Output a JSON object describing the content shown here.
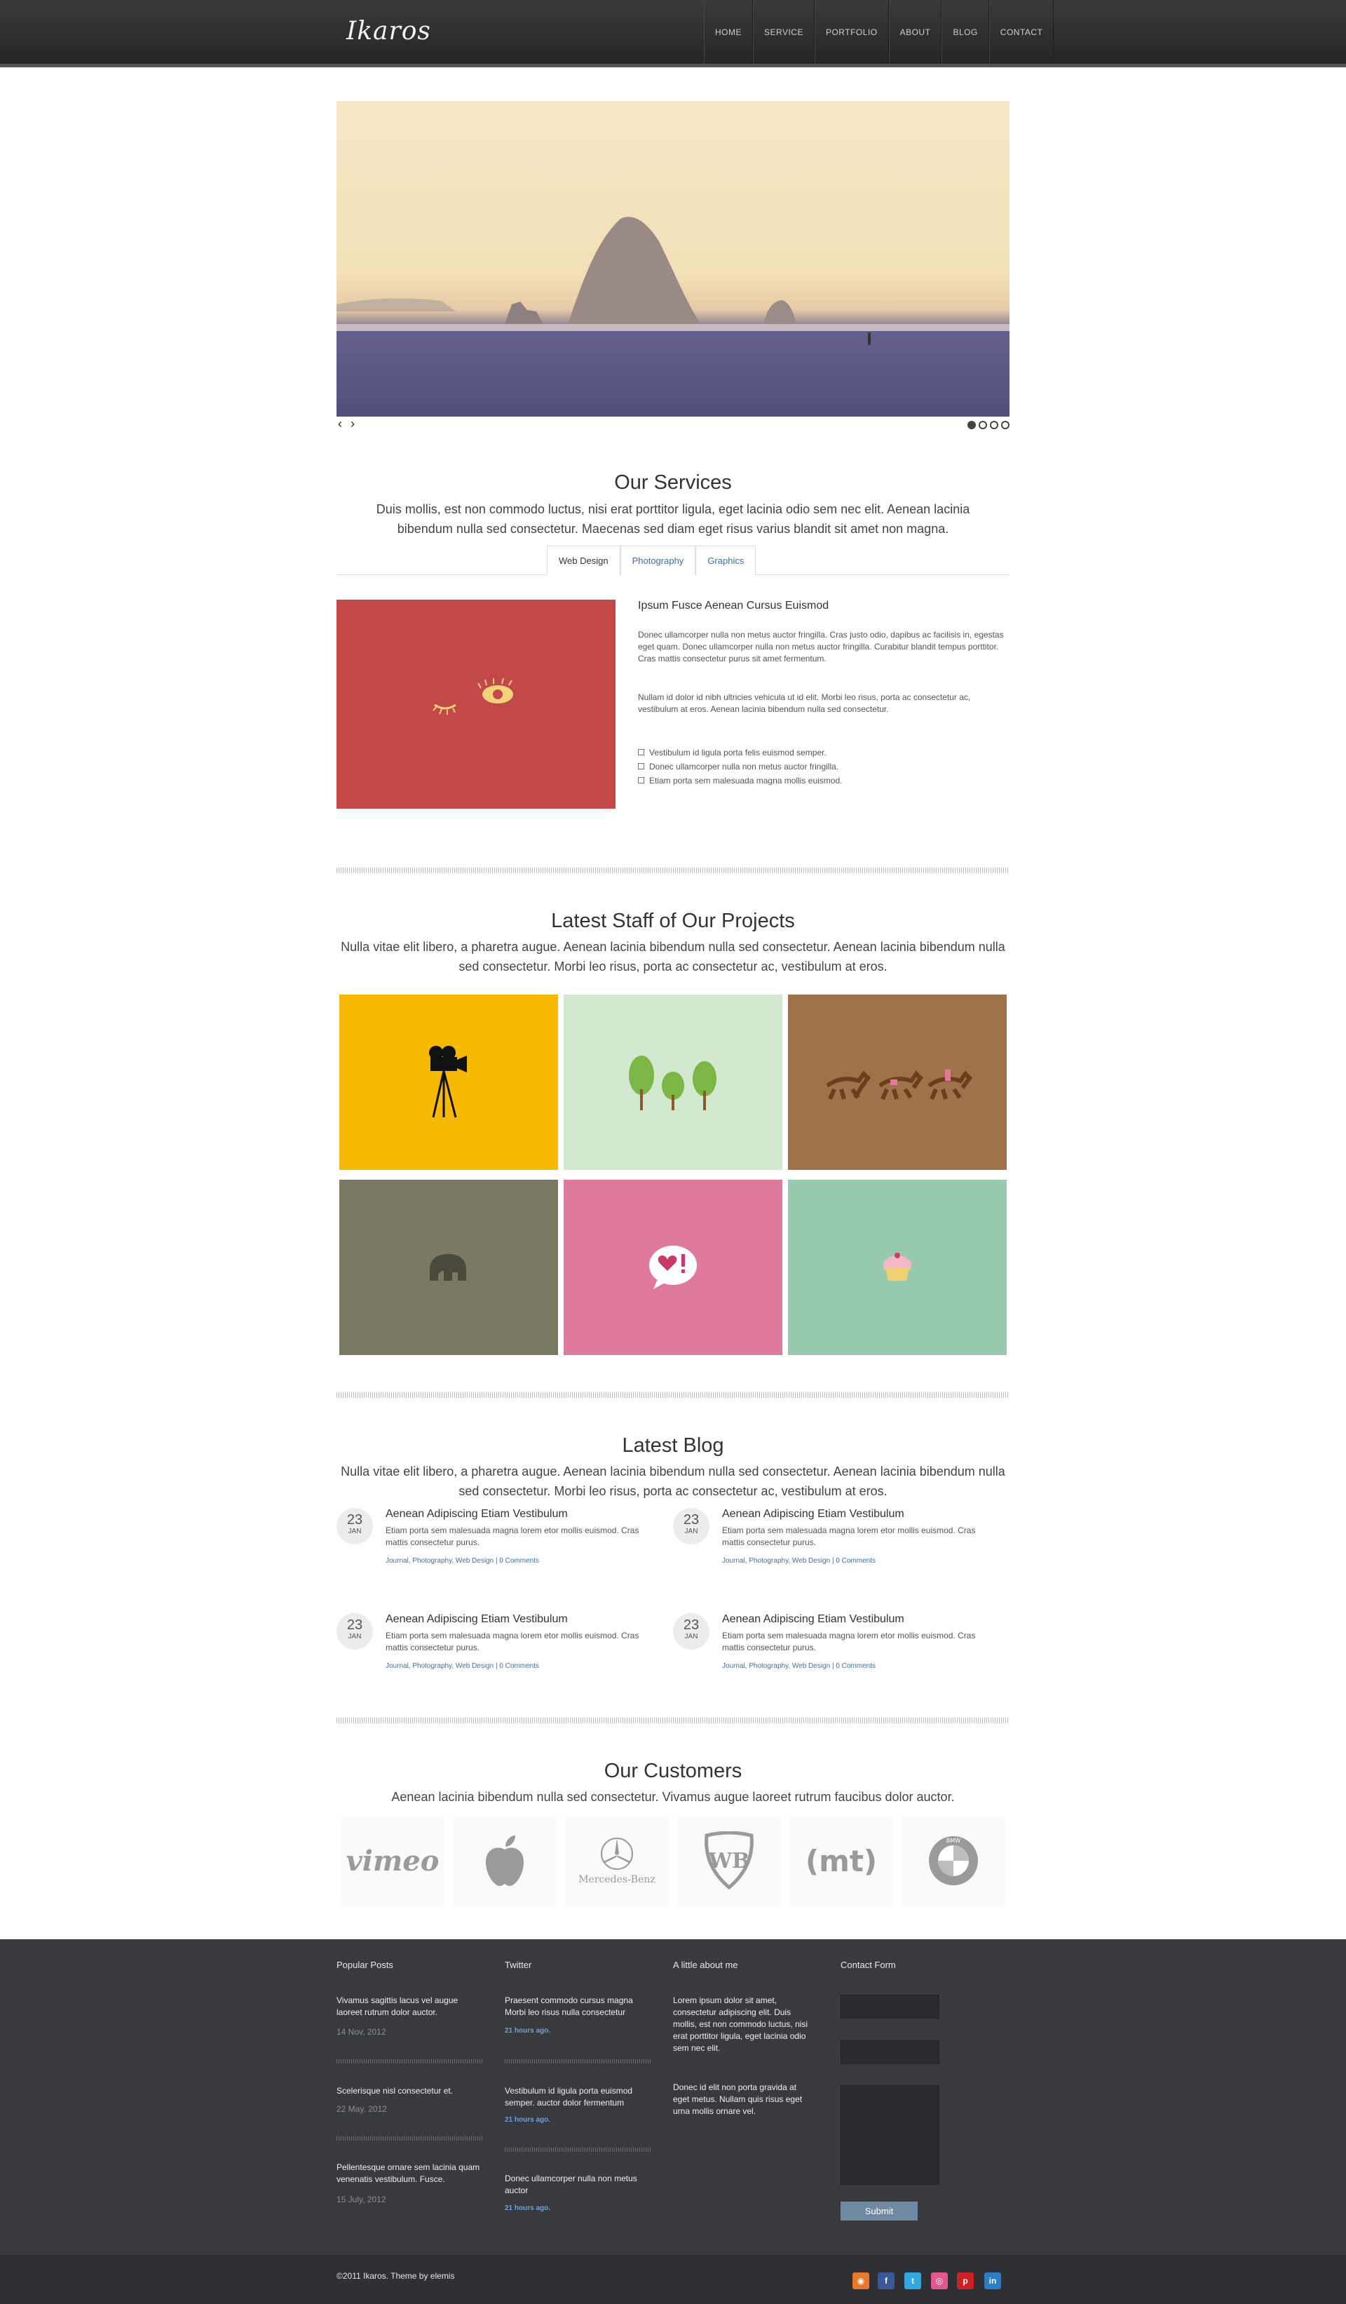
{
  "header": {
    "logo": "Ikaros",
    "nav": [
      "HOME",
      "SERVICE",
      "PORTFOLIO",
      "ABOUT",
      "BLOG",
      "CONTACT"
    ]
  },
  "slider": {
    "prev": "‹",
    "next": "›",
    "dots": 4,
    "active_dot": 1
  },
  "services": {
    "title": "Our Services",
    "subtitle": "Duis mollis, est non commodo luctus, nisi erat porttitor ligula, eget lacinia odio sem nec elit. Aenean lacinia bibendum nulla sed consectetur. Maecenas sed diam eget risus varius blandit sit amet non magna.",
    "tabs": [
      "Web Design",
      "Photography",
      "Graphics"
    ],
    "active_tab": "Web Design",
    "item_title": "Ipsum Fusce Aenean Cursus Euismod",
    "p1": "Donec ullamcorper nulla non metus auctor fringilla. Cras justo odio, dapibus ac facilisis in, egestas eget quam. Donec ullamcorper nulla non metus auctor fringilla. Curabitur blandit tempus porttitor. Cras mattis consectetur purus sit amet fermentum.",
    "p2": "Nullam id dolor id nibh ultricies vehicula ut id elit. Morbi leo risus, porta ac consectetur ac, vestibulum at eros. Aenean lacinia bibendum nulla sed consectetur.",
    "list": [
      "Vestibulum id ligula porta felis euismod semper.",
      "Donec ullamcorper nulla non metus auctor fringilla.",
      "Etiam porta sem malesuada magna mollis euismod."
    ]
  },
  "projects": {
    "title": "Latest Staff of Our Projects",
    "subtitle": "Nulla vitae elit libero, a pharetra augue. Aenean lacinia bibendum nulla sed consectetur. Aenean lacinia bibendum nulla sed consectetur. Morbi leo risus, porta ac consectetur ac, vestibulum at eros.",
    "items": [
      {
        "icon": "camera-icon",
        "color": "#f6b800"
      },
      {
        "icon": "trees-icon",
        "color": "#d2e8cf"
      },
      {
        "icon": "horses-icon",
        "color": "#a0724a"
      },
      {
        "icon": "elephant-icon",
        "color": "#7a7a62"
      },
      {
        "icon": "heart-bubble-icon",
        "color": "#e07a9b"
      },
      {
        "icon": "cupcake-icon",
        "color": "#96c9ad"
      }
    ]
  },
  "blog": {
    "title": "Latest Blog",
    "subtitle": "Nulla vitae elit libero, a pharetra augue. Aenean lacinia bibendum nulla sed consectetur. Aenean lacinia bibendum nulla sed consectetur. Morbi leo risus, porta ac consectetur ac, vestibulum at eros.",
    "posts": [
      {
        "day": "23",
        "month": "JAN",
        "title": "Aenean Adipiscing Etiam Vestibulum",
        "text": "Etiam porta sem malesuada magna lorem etor mollis euismod. Cras mattis consectetur purus.",
        "meta": "Journal, Photography, Web Design | 0 Comments"
      },
      {
        "day": "23",
        "month": "JAN",
        "title": "Aenean Adipiscing Etiam Vestibulum",
        "text": "Etiam porta sem malesuada magna lorem etor mollis euismod. Cras mattis consectetur purus.",
        "meta": "Journal, Photography, Web Design | 0 Comments"
      },
      {
        "day": "23",
        "month": "JAN",
        "title": "Aenean Adipiscing Etiam Vestibulum",
        "text": "Etiam porta sem malesuada magna lorem etor mollis euismod. Cras mattis consectetur purus.",
        "meta": "Journal, Photography, Web Design | 0 Comments"
      },
      {
        "day": "23",
        "month": "JAN",
        "title": "Aenean Adipiscing Etiam Vestibulum",
        "text": "Etiam porta sem malesuada magna lorem etor mollis euismod. Cras mattis consectetur purus.",
        "meta": "Journal, Photography, Web Design | 0 Comments"
      }
    ]
  },
  "customers": {
    "title": "Our Customers",
    "subtitle": "Aenean lacinia bibendum nulla sed consectetur. Vivamus augue laoreet rutrum faucibus dolor auctor.",
    "logos": [
      "vimeo",
      "apple-logo",
      "Mercedes-Benz",
      "WB",
      "(mt)",
      "BMW"
    ]
  },
  "footer": {
    "popular_title": "Popular Posts",
    "popular": [
      {
        "text": "Vivamus sagittis lacus vel augue laoreet rutrum dolor auctor.",
        "date": "14 Nov, 2012"
      },
      {
        "text": "Scelerisque nisl consectetur et.",
        "date": "22 May, 2012"
      },
      {
        "text": "Pellentesque ornare sem lacinia quam venenatis vestibulum. Fusce.",
        "date": "15 July, 2012"
      }
    ],
    "twitter_title": "Twitter",
    "tweets": [
      {
        "text": "Praesent commodo cursus magna Morbi leo risus nulla consectetur",
        "time": "21 hours ago."
      },
      {
        "text": "Vestibulum id ligula porta euismod semper. auctor dolor fermentum",
        "time": "21 hours ago."
      },
      {
        "text": "Donec ullamcorper nulla non metus auctor",
        "time": "21 hours ago."
      }
    ],
    "about_title": "A little about me",
    "about_p1": "Lorem ipsum dolor sit amet, consectetur adipiscing elit. Duis mollis, est non commodo luctus, nisi erat porttitor ligula, eget lacinia odio sem nec elit.",
    "about_p2": "Donec id elit non porta gravida at eget metus. Nullam quis risus eget urna mollis ornare vel.",
    "contact_title": "Contact Form",
    "submit": "Submit",
    "copyright": "©2011 Ikaros. Theme by elemis",
    "social": [
      {
        "icon": "rss-icon",
        "glyph": "◉",
        "color": "#e8792c"
      },
      {
        "icon": "facebook-icon",
        "glyph": "f",
        "color": "#3b5998"
      },
      {
        "icon": "twitter-icon",
        "glyph": "t",
        "color": "#33a8e0"
      },
      {
        "icon": "dribbble-icon",
        "glyph": "◎",
        "color": "#e0588e"
      },
      {
        "icon": "pinterest-icon",
        "glyph": "p",
        "color": "#cc2127"
      },
      {
        "icon": "linkedin-icon",
        "glyph": "in",
        "color": "#2d7dc4"
      }
    ]
  }
}
